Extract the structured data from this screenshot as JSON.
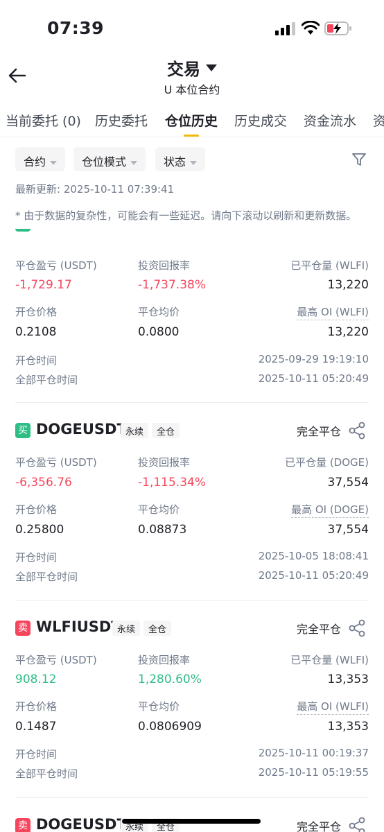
{
  "status_bar": {
    "time": "07:39"
  },
  "header": {
    "title": "交易",
    "subtitle": "U 本位合约"
  },
  "tabs": [
    {
      "label": "当前委托 (0)"
    },
    {
      "label": "历史委托"
    },
    {
      "label": "仓位历史",
      "active": true
    },
    {
      "label": "历史成交"
    },
    {
      "label": "资金流水"
    },
    {
      "label": "资"
    }
  ],
  "filters": [
    {
      "label": "合约"
    },
    {
      "label": "仓位模式"
    },
    {
      "label": "状态"
    }
  ],
  "last_updated": "最新更新: 2025-10-11 07:39:41",
  "note": "* 由于数据的复杂性，可能会有一些延迟。请向下滚动以刷新和更新数据。",
  "labels": {
    "pnl": "平仓盈亏 (USDT)",
    "roi": "投资回报率",
    "open_price": "开仓价格",
    "avg_close": "平仓均价",
    "open_time": "开仓时间",
    "full_close_time": "全部平仓时间"
  },
  "colors": {
    "buy": "#2ebd85",
    "sell": "#f6465d",
    "accent": "#f0b90b"
  },
  "cards": [
    {
      "side": "",
      "symbol": "",
      "tag1": "",
      "tag2": "",
      "status": "",
      "pnl": "-1,729.17",
      "roi": "-1,737.38%",
      "closed_qty_label": "已平仓量 (WLFI)",
      "closed_qty": "13,220",
      "open_price": "0.2108",
      "avg_close": "0.0800",
      "max_oi_label": "最高 OI (WLFI)",
      "max_oi": "13,220",
      "open_time": "2025-09-29 19:19:10",
      "full_close_time": "2025-10-11 05:20:49"
    },
    {
      "side": "买",
      "symbol": "DOGEUSDT",
      "tag1": "永续",
      "tag2": "全仓",
      "status": "完全平仓",
      "pnl": "-6,356.76",
      "roi": "-1,115.34%",
      "closed_qty_label": "已平仓量 (DOGE)",
      "closed_qty": "37,554",
      "open_price": "0.25800",
      "avg_close": "0.08873",
      "max_oi_label": "最高 OI (DOGE)",
      "max_oi": "37,554",
      "open_time": "2025-10-05 18:08:41",
      "full_close_time": "2025-10-11 05:20:49"
    },
    {
      "side": "卖",
      "symbol": "WLFIUSDT",
      "tag1": "永续",
      "tag2": "全仓",
      "status": "完全平仓",
      "pnl": "908.12",
      "roi": "1,280.60%",
      "closed_qty_label": "已平仓量 (WLFI)",
      "closed_qty": "13,353",
      "open_price": "0.1487",
      "avg_close": "0.0806909",
      "max_oi_label": "最高 OI (WLFI)",
      "max_oi": "13,353",
      "open_time": "2025-10-11 00:19:37",
      "full_close_time": "2025-10-11 05:19:55"
    },
    {
      "side": "卖",
      "symbol": "DOGEUSDT",
      "tag1": "永续",
      "tag2": "全仓",
      "status": "完全平仓"
    }
  ]
}
